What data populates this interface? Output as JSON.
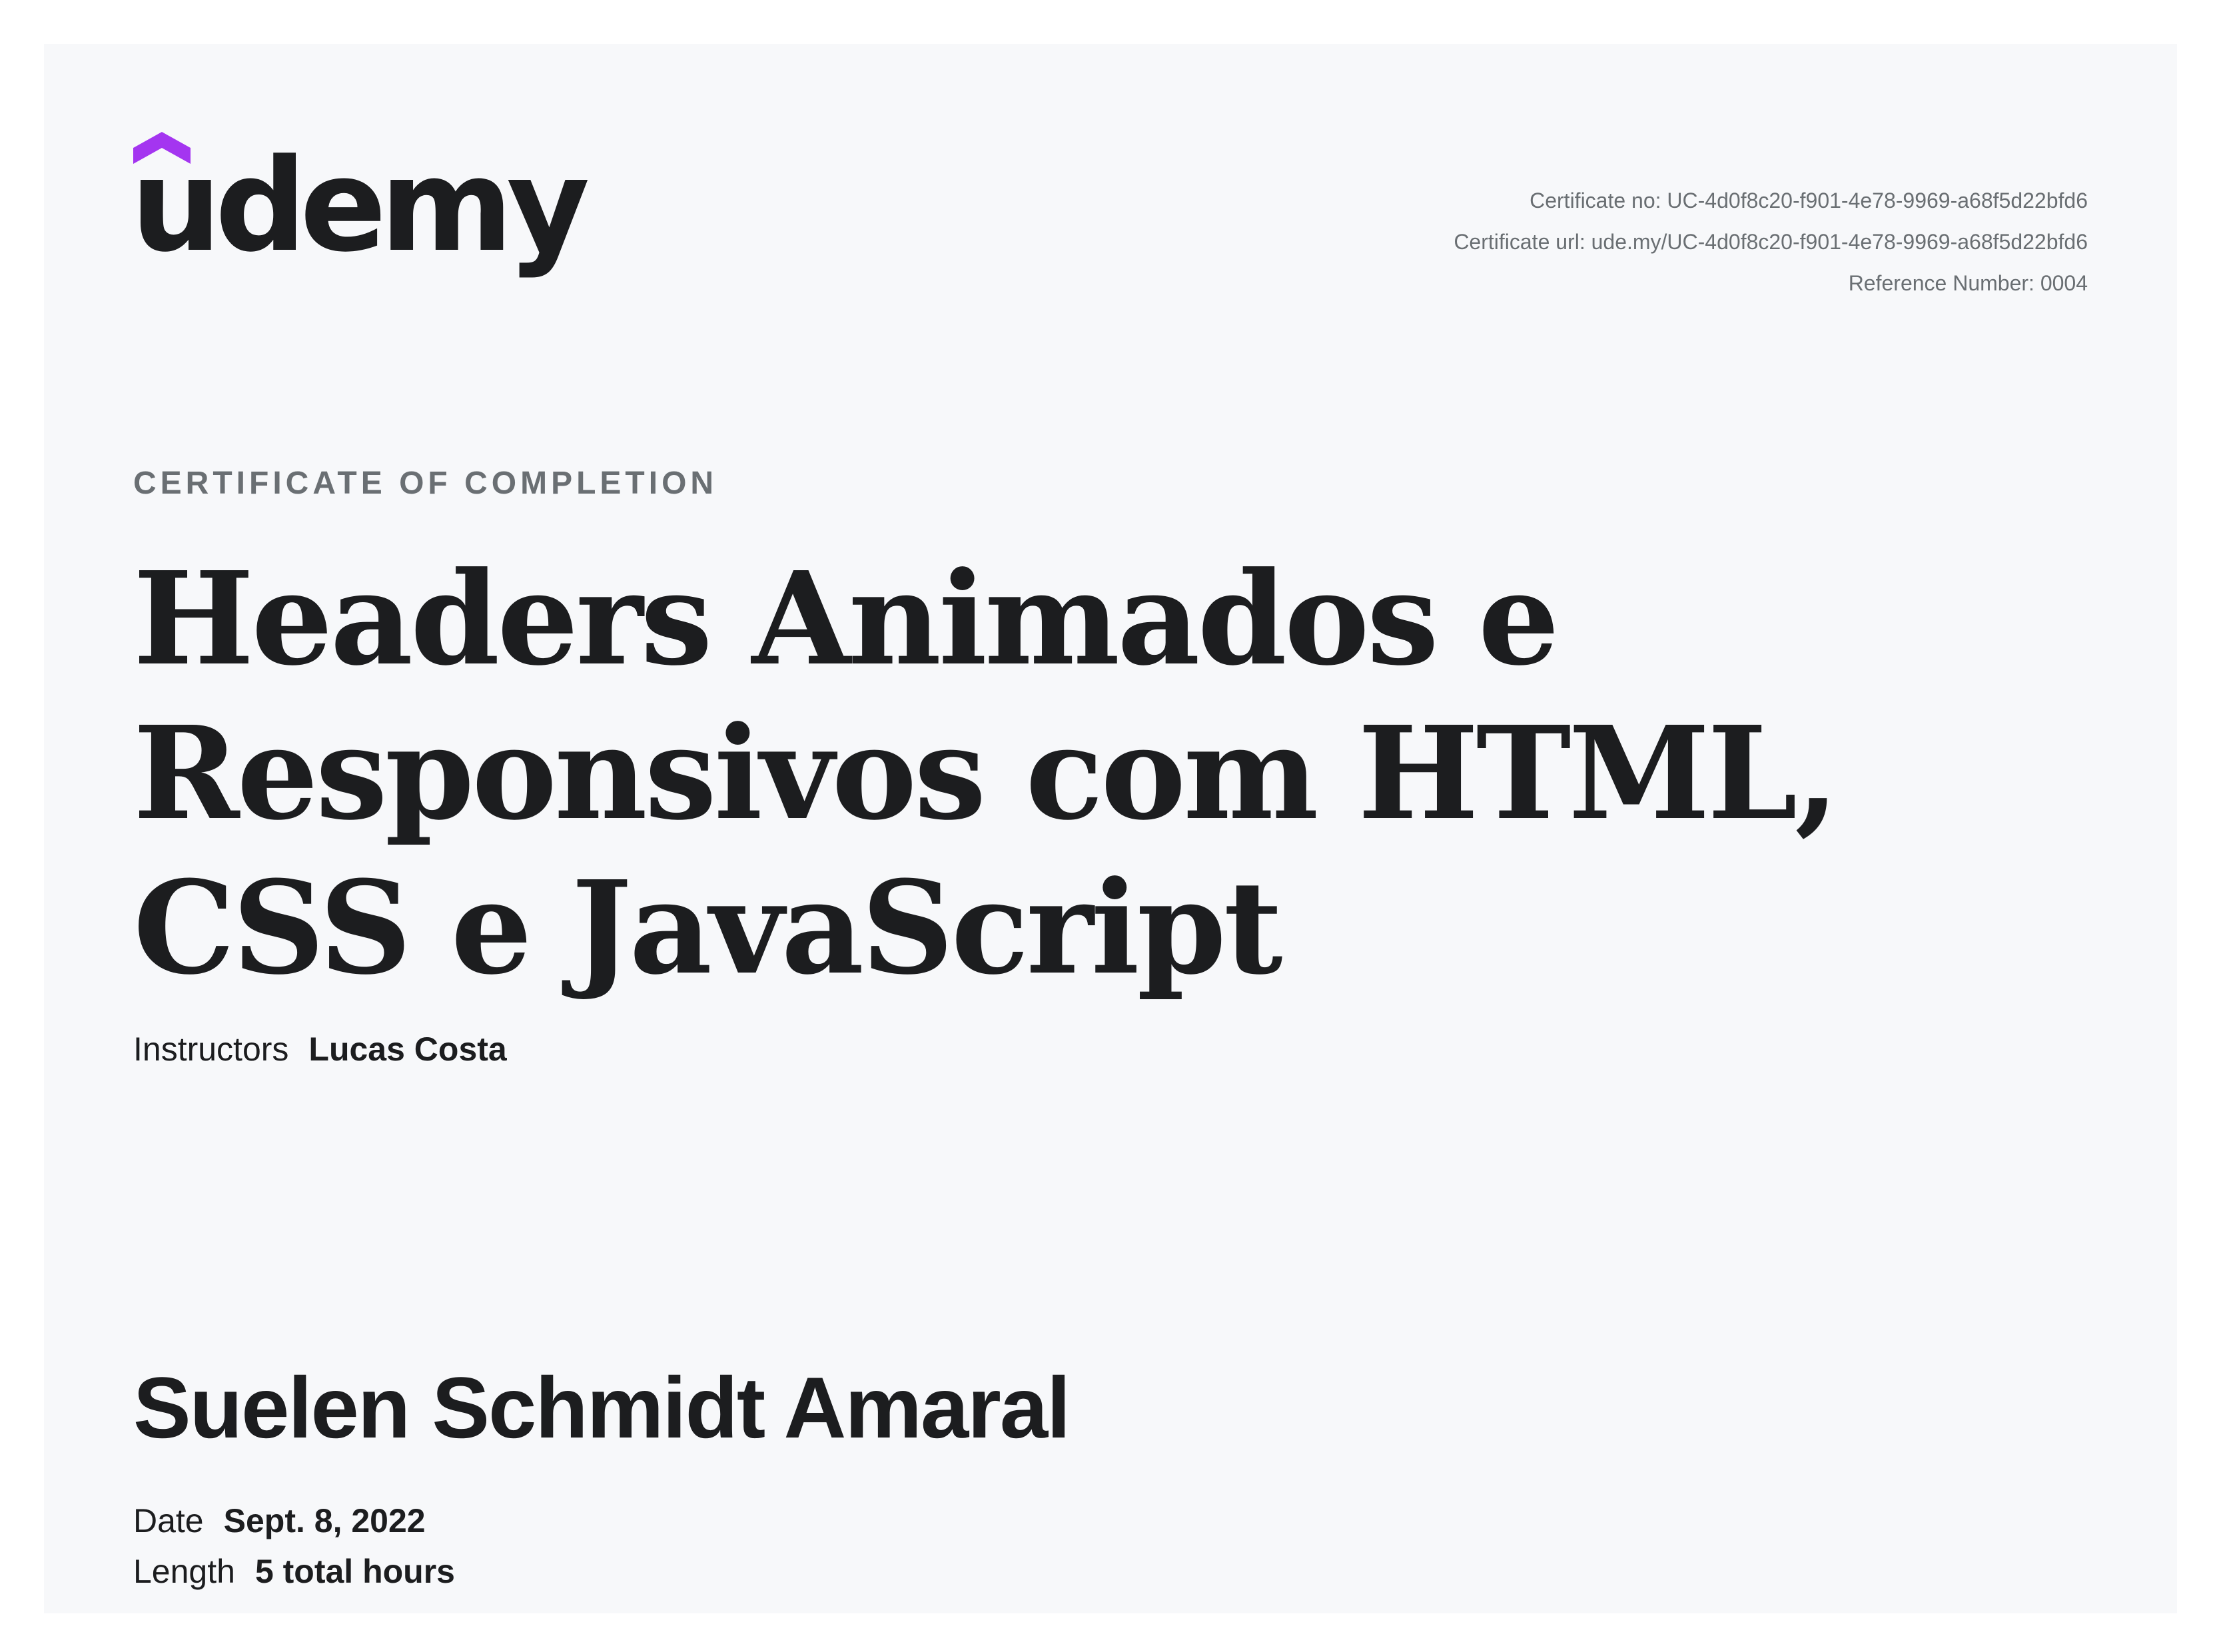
{
  "brand": {
    "name": "udemy",
    "accent_color": "#a435f0"
  },
  "certificate_meta": {
    "certificate_no": "Certificate no: UC-4d0f8c20-f901-4e78-9969-a68f5d22bfd6",
    "certificate_url": "Certificate url: ude.my/UC-4d0f8c20-f901-4e78-9969-a68f5d22bfd6",
    "reference_number": "Reference Number: 0004"
  },
  "kicker": "CERTIFICATE OF COMPLETION",
  "course": {
    "title": "Headers Animados e Responsivos com HTML, CSS e JavaScript"
  },
  "instructors": {
    "label": "Instructors",
    "names": "Lucas Costa"
  },
  "student": {
    "name": "Suelen Schmidt Amaral"
  },
  "details": {
    "date_label": "Date",
    "date_value": "Sept. 8, 2022",
    "length_label": "Length",
    "length_value": "5 total hours"
  }
}
